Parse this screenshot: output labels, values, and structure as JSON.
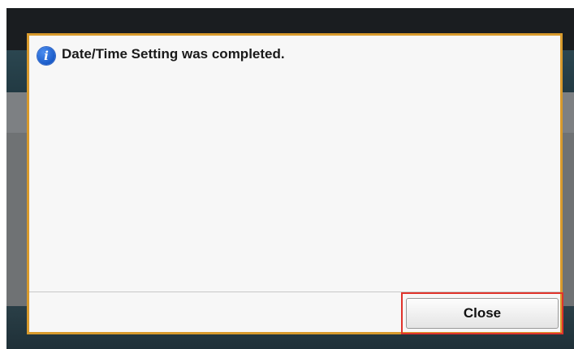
{
  "dialog": {
    "message": "Date/Time Setting was completed.",
    "icon": "info-icon",
    "close_label": "Close"
  },
  "colors": {
    "dialog_border": "#d89a2c",
    "highlight": "#e0332b",
    "info_blue": "#1a5bc8"
  }
}
